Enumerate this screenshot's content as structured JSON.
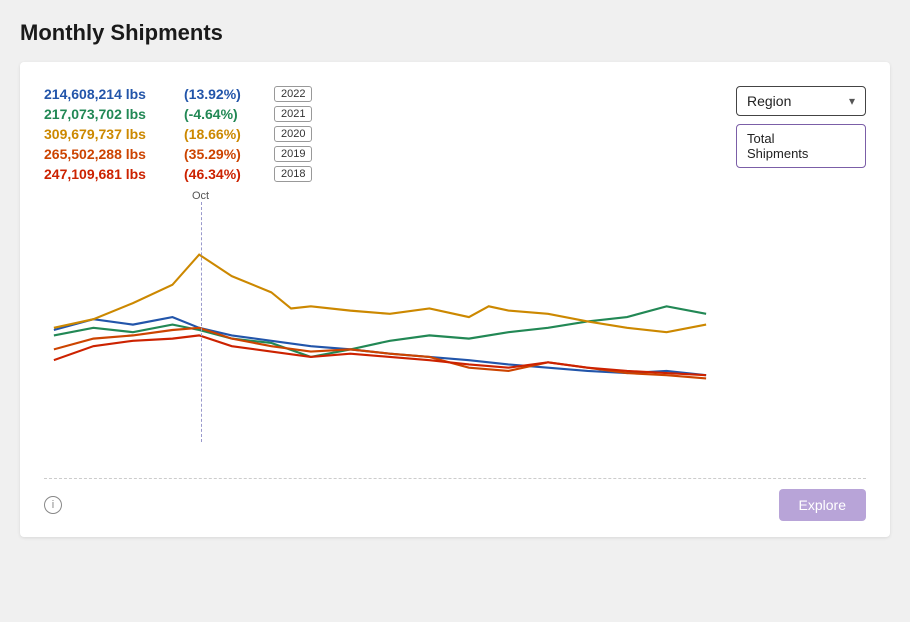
{
  "page": {
    "title": "Monthly Shipments"
  },
  "stats": [
    {
      "value": "214,608,214 lbs",
      "pct": "(13.92%)",
      "year": "2022",
      "color": "blue",
      "pctColor": "blue"
    },
    {
      "value": "217,073,702 lbs",
      "pct": "(-4.64%)",
      "year": "2021",
      "color": "green",
      "pctColor": "green"
    },
    {
      "value": "309,679,737 lbs",
      "pct": "(18.66%)",
      "year": "2020",
      "color": "yellow",
      "pctColor": "yellow"
    },
    {
      "value": "265,502,288 lbs",
      "pct": "(35.29%)",
      "year": "2019",
      "color": "orange",
      "pctColor": "orange"
    },
    {
      "value": "247,109,681 lbs",
      "pct": "(46.34%)",
      "year": "2018",
      "color": "red",
      "pctColor": "red"
    }
  ],
  "chart": {
    "vertical_label": "Oct"
  },
  "dropdown": {
    "label": "Region",
    "chevron": "▾",
    "option": "Total\nShipments"
  },
  "footer": {
    "info_icon": "i",
    "explore_label": "Explore"
  }
}
